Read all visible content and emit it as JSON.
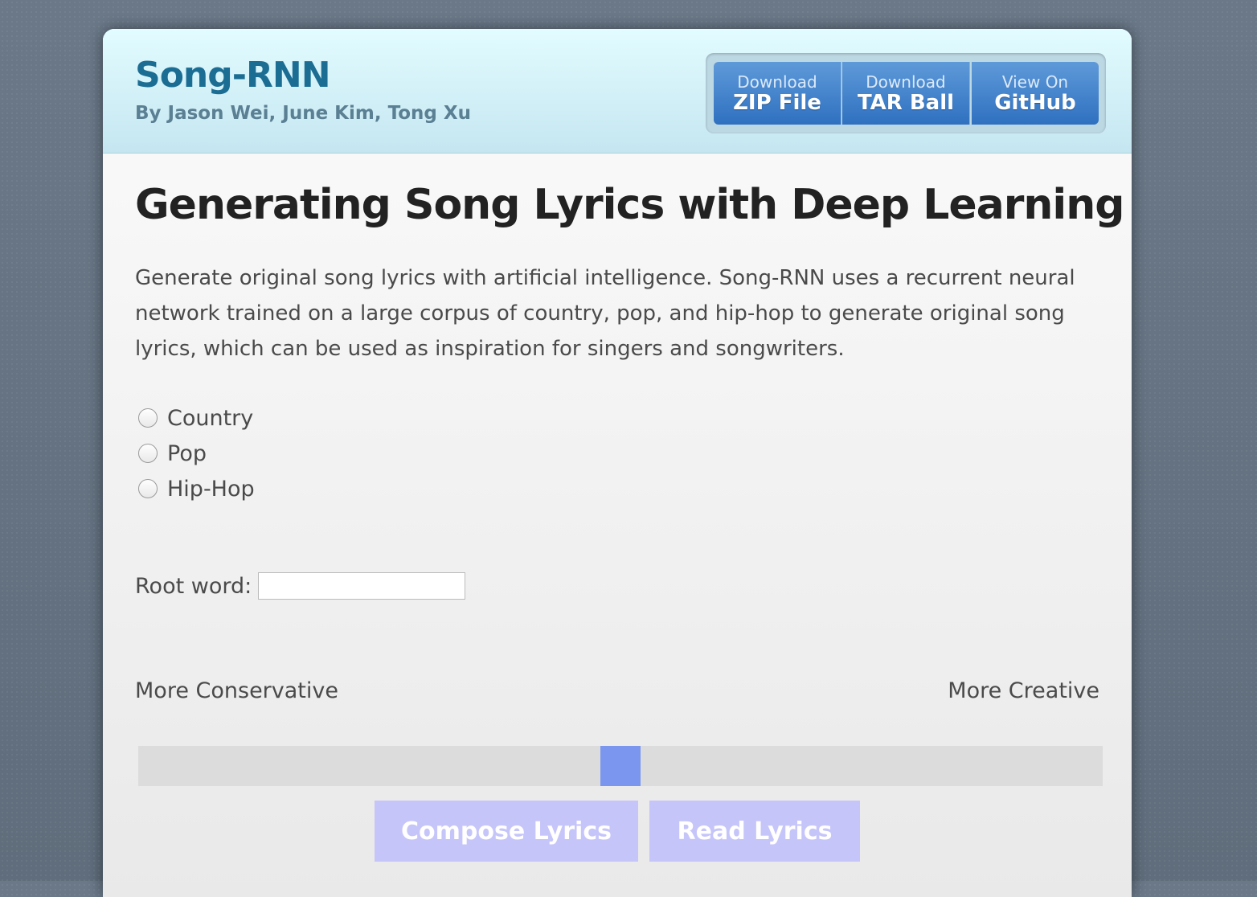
{
  "header": {
    "title": "Song-RNN",
    "tagline": "By Jason Wei, June Kim, Tong Xu",
    "downloads": [
      {
        "small": "Download",
        "big": "ZIP File"
      },
      {
        "small": "Download",
        "big": "TAR Ball"
      },
      {
        "small": "View On",
        "big": "GitHub"
      }
    ]
  },
  "main": {
    "heading": "Generating Song Lyrics with Deep Learning",
    "intro": "Generate original song lyrics with artificial intelligence. Song-RNN uses a recurrent neural network trained on a large corpus of country, pop, and hip-hop to generate original song lyrics, which can be used as inspiration for singers and songwriters.",
    "genres": [
      "Country",
      "Pop",
      "Hip-Hop"
    ],
    "root_word": {
      "label": "Root word:",
      "value": ""
    },
    "creativity": {
      "left_label": "More Conservative",
      "right_label": "More Creative",
      "value_fraction": 0.5
    },
    "buttons": {
      "compose": "Compose Lyrics",
      "read": "Read Lyrics"
    }
  },
  "colors": {
    "title": "#1b6d93",
    "slider_thumb": "#7b96ee",
    "action_button": "#c6c5fa",
    "download_button": "#3f80cc"
  }
}
